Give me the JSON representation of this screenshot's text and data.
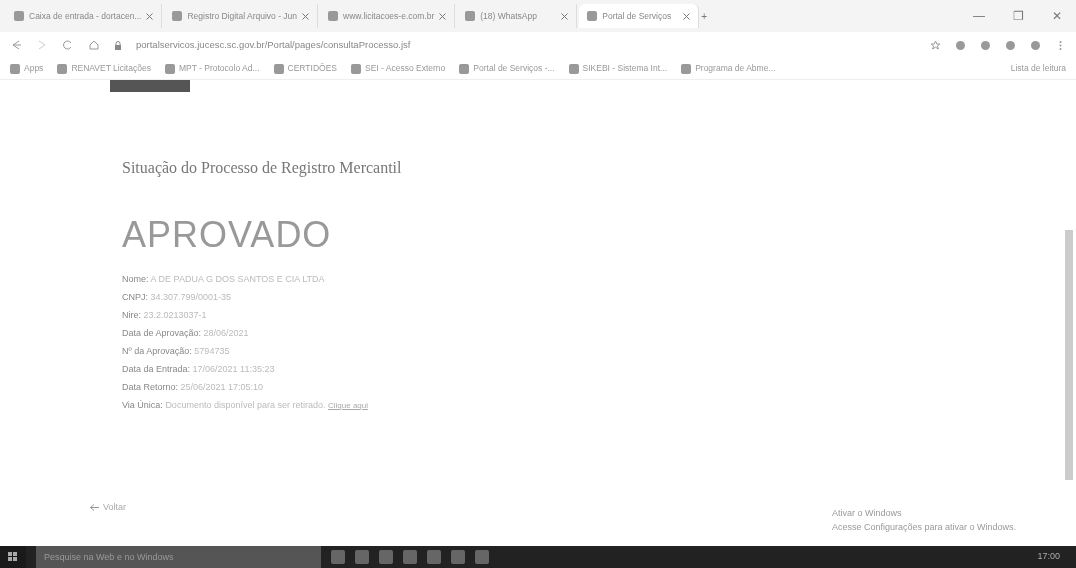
{
  "browser": {
    "tabs": [
      {
        "title": "Caixa de entrada - dortacen...",
        "selected": false
      },
      {
        "title": "Registro Digital Arquivo - Jun",
        "selected": false
      },
      {
        "title": "www.licitacoes-e.com.br",
        "selected": false
      },
      {
        "title": "(18) WhatsApp",
        "selected": false
      },
      {
        "title": "Portal de Serviços",
        "selected": true
      }
    ],
    "new_tab": "+",
    "window_controls": [
      "—",
      "❐",
      "✕"
    ],
    "address": "portalservicos.jucesc.sc.gov.br/Portal/pages/consultaProcesso.jsf",
    "bookmarks": [
      "Apps",
      "RENAVET Licitações",
      "MPT - Protocolo Ad...",
      "CERTIDÕES",
      "SEI - Acesso Externo",
      "Portal de Serviços -...",
      "SIKEBI - Sistema Int...",
      "Programa de Abme..."
    ],
    "reading_list": "Lista de leitura"
  },
  "page": {
    "heading": "Situação do Processo de Registro Mercantil",
    "status": "APROVADO",
    "fields": [
      {
        "label": "Nome:",
        "value": "A DE PADUA G DOS SANTOS E CIA LTDA"
      },
      {
        "label": "CNPJ:",
        "value": "34.307.799/0001-35"
      },
      {
        "label": "Nire:",
        "value": "23.2.0213037-1"
      },
      {
        "label": "Data de Aprovação:",
        "value": "28/06/2021"
      },
      {
        "label": "Nº da Aprovação:",
        "value": "5794735"
      },
      {
        "label": "Data da Entrada:",
        "value": "17/06/2021 11:35:23"
      },
      {
        "label": "Data Retorno:",
        "value": "25/06/2021 17:05:10"
      },
      {
        "label": "Via Única:",
        "value": "Documento disponível para ser retirado.",
        "link": "Clique aqui"
      }
    ],
    "back": "Voltar"
  },
  "activation": {
    "title": "Ativar o Windows",
    "text": "Acesse Configurações para ativar o Windows."
  },
  "taskbar": {
    "search_placeholder": "Pesquise na Web e no Windows",
    "time": "17:00"
  }
}
